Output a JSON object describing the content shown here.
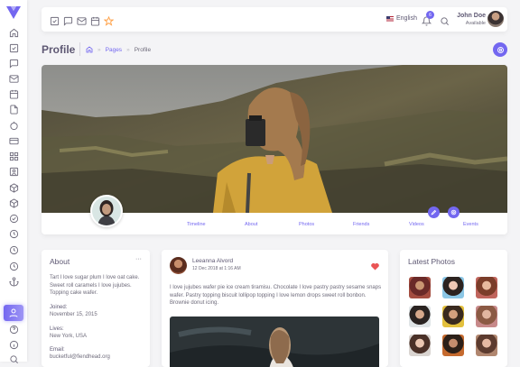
{
  "sidebar": {
    "icons": [
      "logo-icon",
      "home-icon",
      "check-square-icon",
      "message-icon",
      "mail-icon",
      "calendar-icon",
      "file-icon",
      "circle-icon",
      "credit-card-icon",
      "grid-icon",
      "user-box-icon",
      "box-icon",
      "box-icon",
      "check-circle-icon",
      "clock-icon",
      "clock-icon",
      "anchor-icon",
      "user-icon",
      "help-icon",
      "info-icon",
      "search-icon"
    ],
    "active": "user-icon"
  },
  "navbar": {
    "bookmarks": [
      "check-square-icon",
      "message-icon",
      "mail-icon",
      "calendar-icon",
      "star-icon"
    ],
    "language": "English",
    "notifications_count": "6",
    "user_name": "John Doe",
    "user_status": "Available"
  },
  "header": {
    "title": "Profile",
    "breadcrumb": {
      "home_icon": "home-icon",
      "pages": "Pages",
      "current": "Profile"
    }
  },
  "profile": {
    "tabs": [
      "Timeline",
      "About",
      "Photos",
      "Friends",
      "Videos",
      "Events"
    ]
  },
  "about": {
    "title": "About",
    "menu": "···",
    "bio": "Tart I love sugar plum I love oat cake. Sweet roll caramels I love jujubes. Topping cake wafer.",
    "joined_label": "Joined:",
    "joined_value": "November 15, 2015",
    "lives_label": "Lives:",
    "lives_value": "New York, USA",
    "email_label": "Email:",
    "email_value": "bucketful@fiendhead.org"
  },
  "post": {
    "author": "Leeanna Alvord",
    "date": "12 Dec 2018 at 1:16 AM",
    "text": "I love jujubes wafer pie ice cream tiramisu. Chocolate I love pastry pastry sesame snaps wafer. Pastry topping biscuit lollipop topping I love lemon drops sweet roll bonbon. Brownie donut icing."
  },
  "latest_photos": {
    "title": "Latest Photos"
  },
  "colors": {
    "accent": "#7367f0",
    "heart": "#ea5455"
  }
}
